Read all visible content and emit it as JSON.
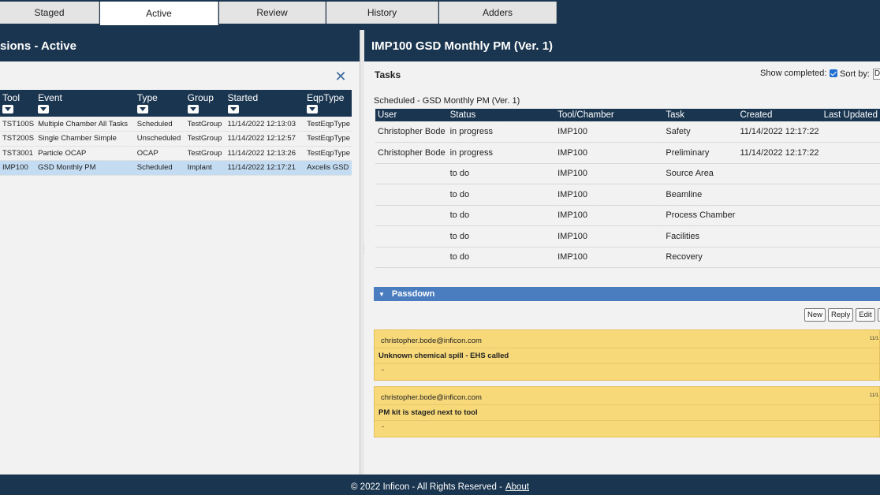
{
  "tabs": [
    "Staged",
    "Active",
    "Review",
    "History",
    "Adders"
  ],
  "left": {
    "title": "sions - Active",
    "columns": [
      "Tool",
      "Event",
      "Type",
      "Group",
      "Started",
      "EqpType"
    ],
    "rows": [
      {
        "tool": "TST100S",
        "event": "Multiple Chamber All Tasks",
        "type": "Scheduled",
        "group": "TestGroup",
        "started": "11/14/2022 12:13:03",
        "eqptype": "TestEqpType"
      },
      {
        "tool": "TST200S",
        "event": "Single Chamber Simple",
        "type": "Unscheduled",
        "group": "TestGroup",
        "started": "11/14/2022 12:12:57",
        "eqptype": "TestEqpType"
      },
      {
        "tool": "TST3001",
        "event": "Particle OCAP",
        "type": "OCAP",
        "group": "TestGroup",
        "started": "11/14/2022 12:13:26",
        "eqptype": "TestEqpType"
      },
      {
        "tool": "IMP100",
        "event": "GSD Monthly PM",
        "type": "Scheduled",
        "group": "Implant",
        "started": "11/14/2022 12:17:21",
        "eqptype": "Axcelis GSD"
      }
    ],
    "selected_row": 3,
    "close_icon": "close-icon"
  },
  "right": {
    "title": "IMP100 GSD Monthly PM (Ver. 1)",
    "tasks_label": "Tasks",
    "show_completed_label": "Show completed:",
    "show_completed": true,
    "sort_by_label": "Sort by:",
    "sort_by_value": "De",
    "scheduled_label": "Scheduled - GSD Monthly PM (Ver. 1)",
    "columns": [
      "User",
      "Status",
      "Tool/Chamber",
      "Task",
      "Created",
      "Last Updated"
    ],
    "tasks": [
      {
        "user": "Christopher Bode",
        "status": "in progress",
        "tool": "IMP100",
        "task": "Safety",
        "created": "11/14/2022 12:17:22",
        "updated": ""
      },
      {
        "user": "Christopher Bode",
        "status": "in progress",
        "tool": "IMP100",
        "task": "Preliminary",
        "created": "11/14/2022 12:17:22",
        "updated": ""
      },
      {
        "user": "",
        "status": "to do",
        "tool": "IMP100",
        "task": "Source Area",
        "created": "",
        "updated": ""
      },
      {
        "user": "",
        "status": "to do",
        "tool": "IMP100",
        "task": "Beamline",
        "created": "",
        "updated": ""
      },
      {
        "user": "",
        "status": "to do",
        "tool": "IMP100",
        "task": "Process Chamber",
        "created": "",
        "updated": ""
      },
      {
        "user": "",
        "status": "to do",
        "tool": "IMP100",
        "task": "Facilities",
        "created": "",
        "updated": ""
      },
      {
        "user": "",
        "status": "to do",
        "tool": "IMP100",
        "task": "Recovery",
        "created": "",
        "updated": ""
      }
    ],
    "passdown": {
      "label": "Passdown",
      "buttons": [
        "New",
        "Reply",
        "Edit",
        "C"
      ],
      "entries": [
        {
          "author": "christopher.bode@inficon.com",
          "date": "11/1",
          "message": "Unknown chemical spill - EHS called",
          "note": "-"
        },
        {
          "author": "christopher.bode@inficon.com",
          "date": "11/1",
          "message": "PM kit is staged next to tool",
          "note": "-"
        }
      ]
    }
  },
  "footer": {
    "text": "© 2022 Inficon - All Rights Reserved -",
    "link": "About"
  },
  "colors": {
    "navy": "#1a3550",
    "passdown_blue": "#4a7dbf",
    "note_yellow": "#f8d97a",
    "selected_row": "#c3dcf2"
  }
}
